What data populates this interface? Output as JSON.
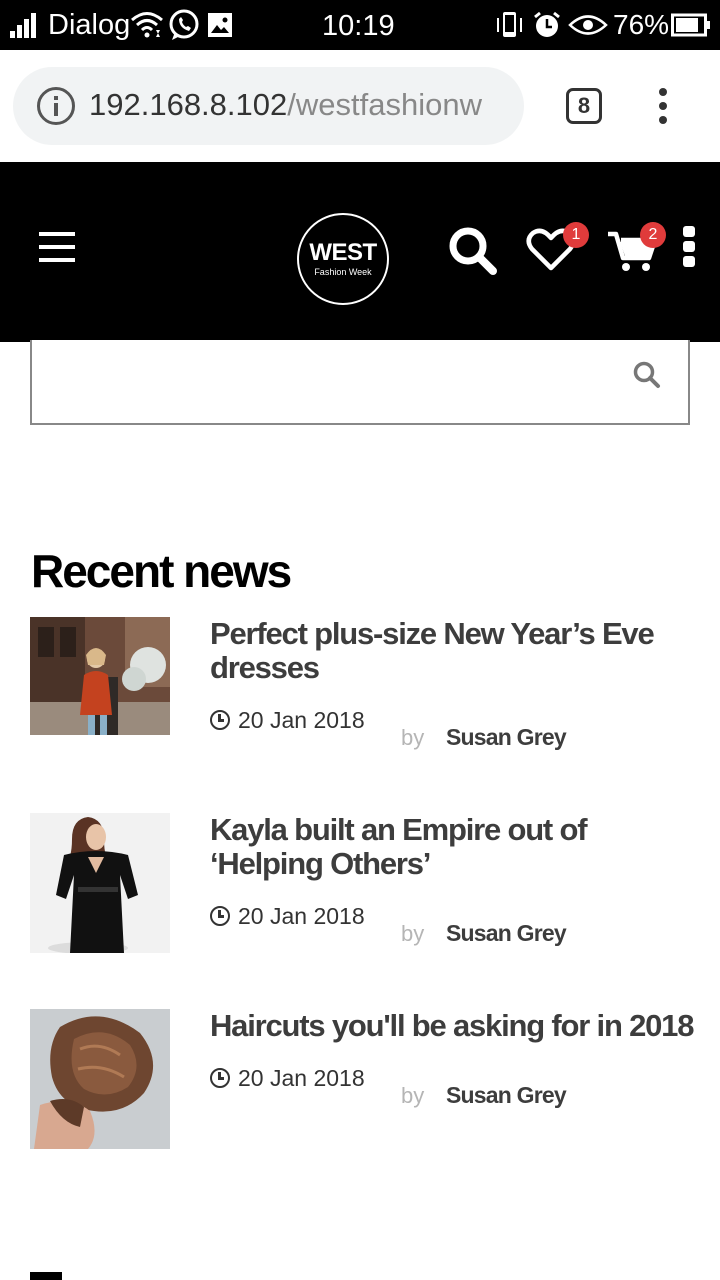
{
  "status_bar": {
    "carrier": "Dialog",
    "time": "10:19",
    "battery": "76%",
    "icons": [
      "signal-icon",
      "wifi-icon",
      "whatsapp-icon",
      "image-icon",
      "vibrate-icon",
      "alarm-icon",
      "eye-icon",
      "battery-icon"
    ]
  },
  "browser": {
    "url_host": "192.168.8.102",
    "url_path": "/westfashionw",
    "tab_count": "8"
  },
  "header": {
    "logo_main": "WEST",
    "logo_sub": "Fashion Week",
    "wishlist_count": "1",
    "cart_count": "2"
  },
  "search": {
    "placeholder": ""
  },
  "recent_news": {
    "title": "Recent news",
    "items": [
      {
        "title": "Perfect plus-size New Year’s Eve dresses",
        "date": "20 Jan 2018",
        "by": "by",
        "author": "Susan Grey"
      },
      {
        "title": "Kayla built an Empire out of ‘Helping Others’",
        "date": "20 Jan 2018",
        "by": "by",
        "author": "Susan Grey"
      },
      {
        "title": "Haircuts you'll be asking for in 2018",
        "date": "20 Jan 2018",
        "by": "by",
        "author": "Susan Grey"
      }
    ]
  },
  "colors": {
    "header_bg": "#000000",
    "badge": "#e03b3b",
    "title_text": "#3d3d3d",
    "muted_text": "#b5b5b5"
  }
}
